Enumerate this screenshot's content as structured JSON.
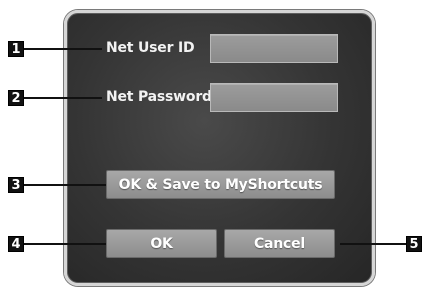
{
  "dialog": {
    "net_user_id_label": "Net User ID",
    "net_user_id_value": "",
    "net_password_label": "Net Password",
    "net_password_value": "",
    "ok_save_label": "OK & Save to MyShortcuts",
    "ok_label": "OK",
    "cancel_label": "Cancel"
  },
  "callouts": [
    "1",
    "2",
    "3",
    "4",
    "5"
  ]
}
